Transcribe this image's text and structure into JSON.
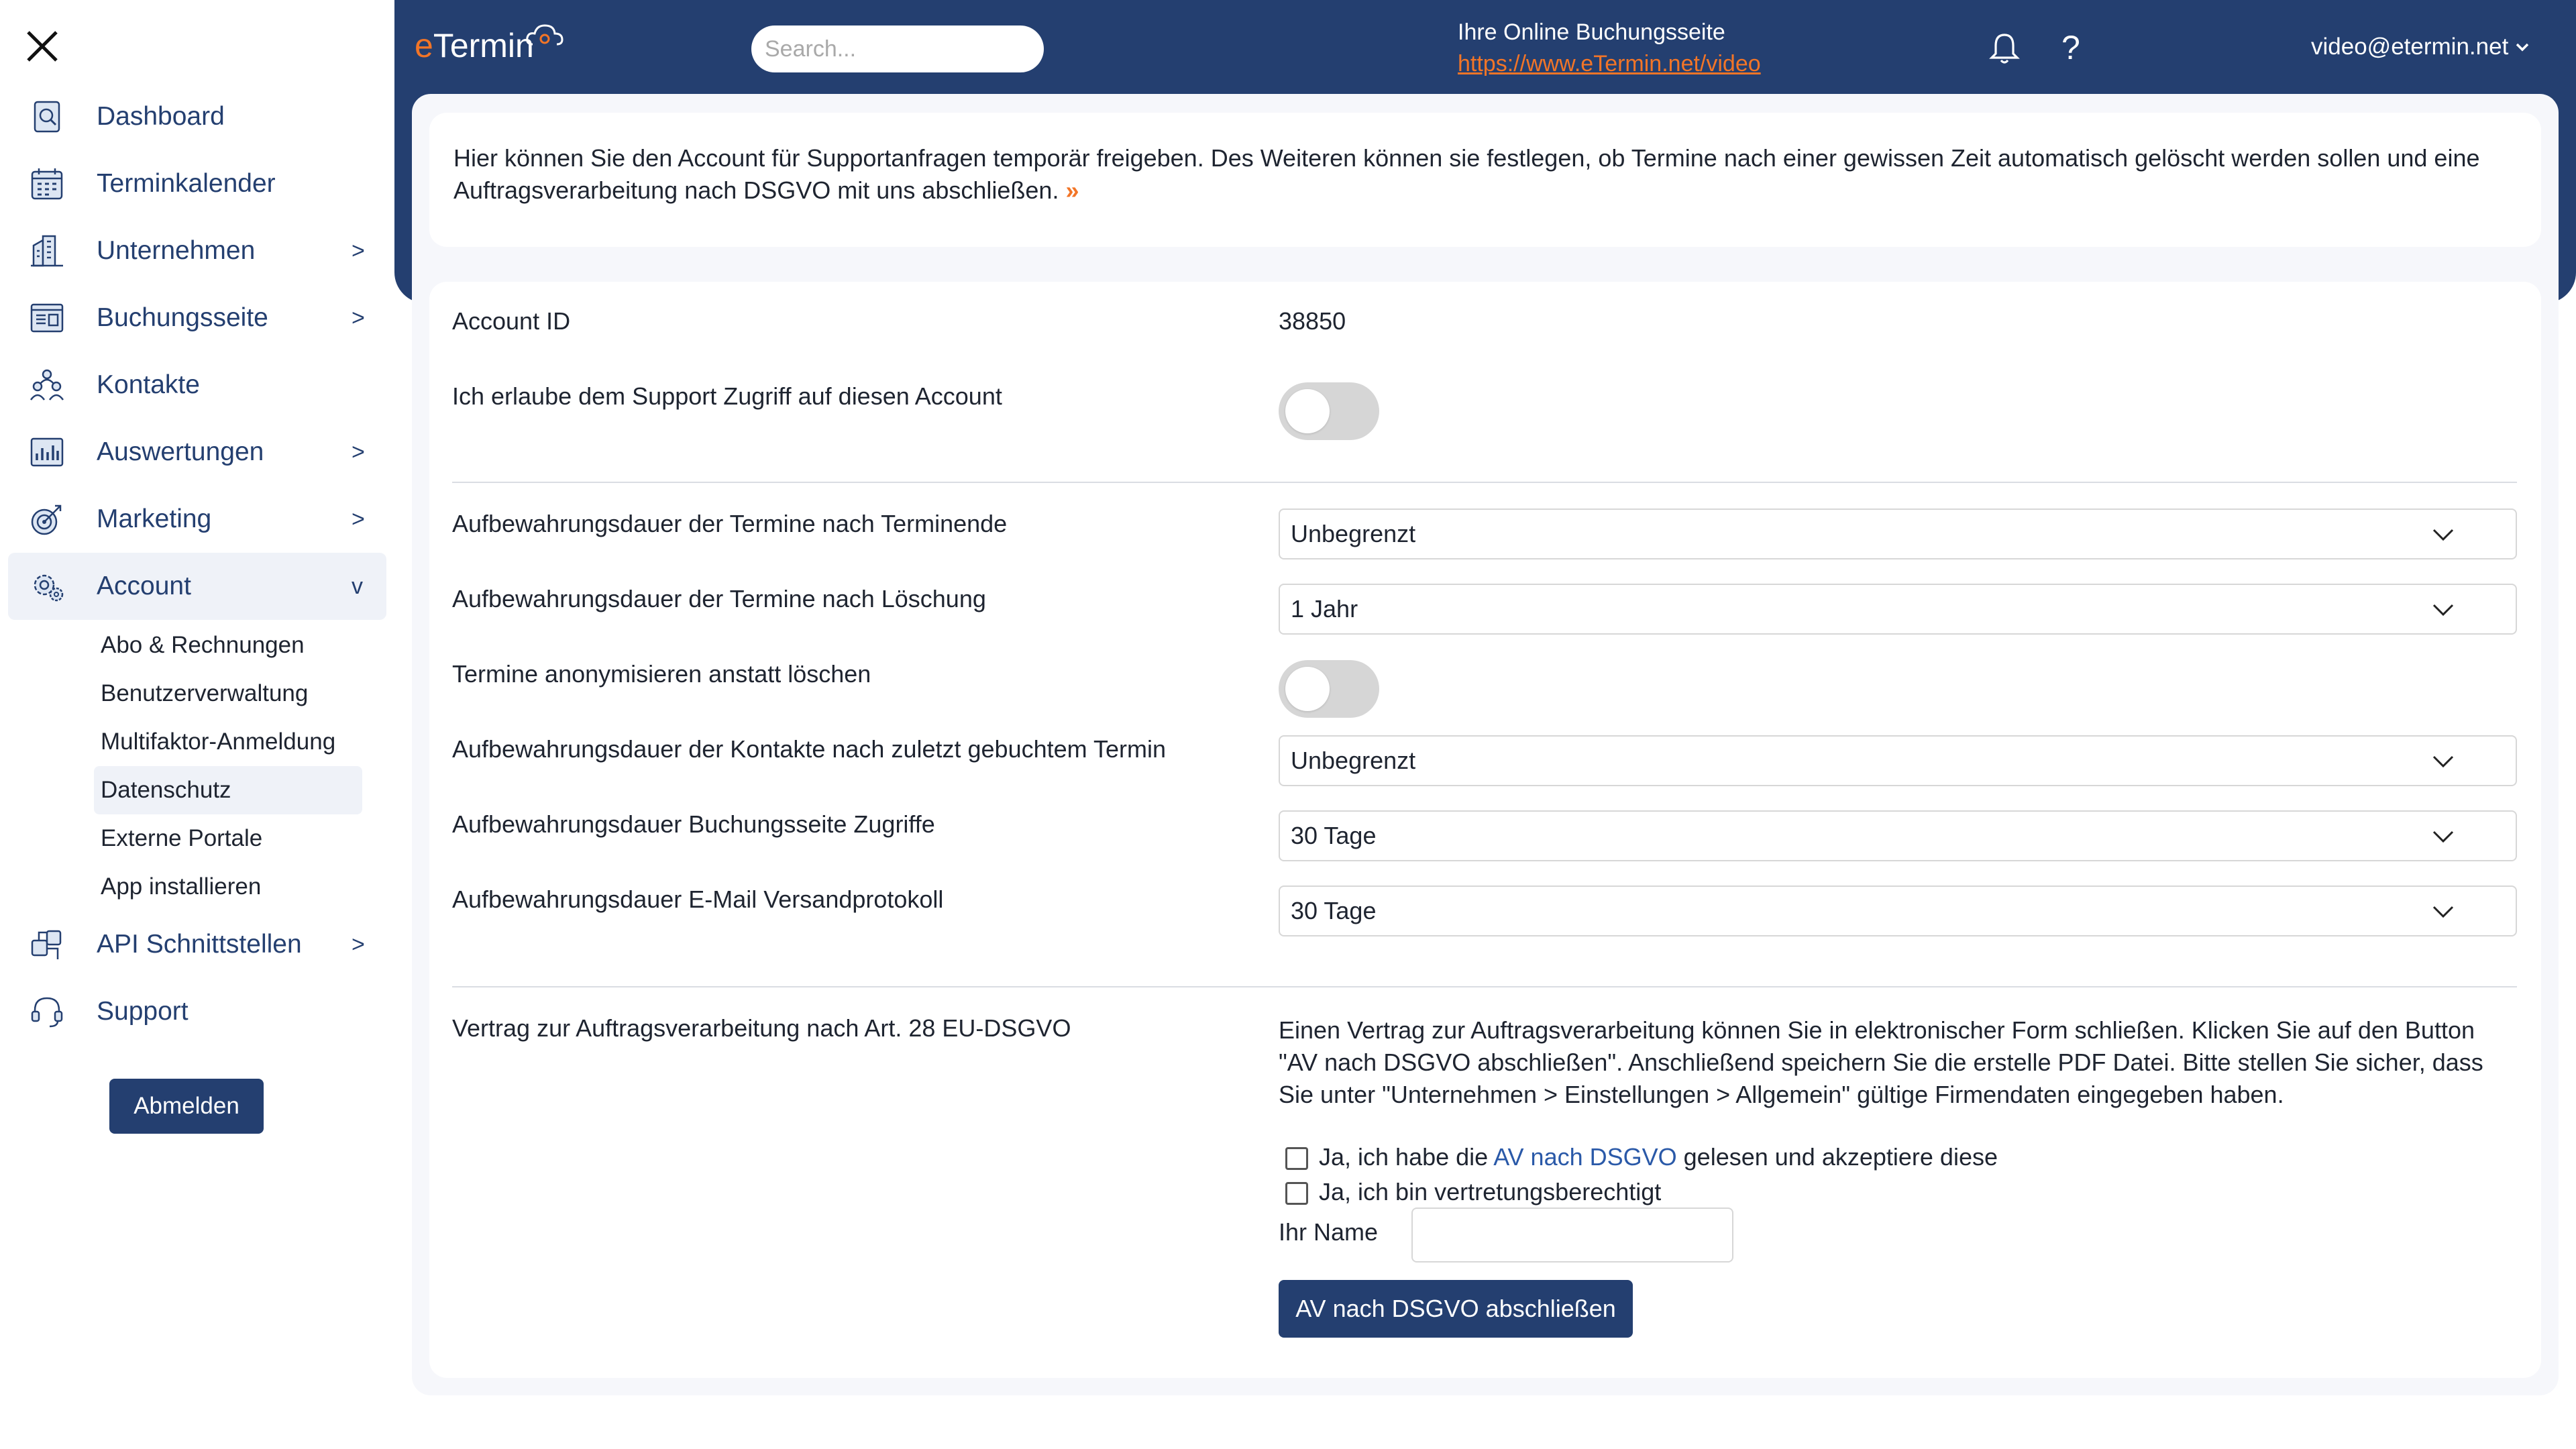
{
  "header": {
    "logo_e": "e",
    "logo_rest": "Termin",
    "search_placeholder": "Search...",
    "booking_title": "Ihre Online Buchungsseite",
    "booking_url": "https://www.eTermin.net/video",
    "help": "?",
    "user_email": "video@etermin.net",
    "user_caret": "⌄"
  },
  "sidebar": {
    "items": [
      {
        "label": "Dashboard",
        "chev": ""
      },
      {
        "label": "Terminkalender",
        "chev": ""
      },
      {
        "label": "Unternehmen",
        "chev": ">"
      },
      {
        "label": "Buchungsseite",
        "chev": ">"
      },
      {
        "label": "Kontakte",
        "chev": ""
      },
      {
        "label": "Auswertungen",
        "chev": ">"
      },
      {
        "label": "Marketing",
        "chev": ">"
      },
      {
        "label": "Account",
        "chev": "v"
      }
    ],
    "sub_items": [
      {
        "label": "Abo & Rechnungen"
      },
      {
        "label": "Benutzerverwaltung"
      },
      {
        "label": "Multifaktor-Anmeldung"
      },
      {
        "label": "Datenschutz"
      },
      {
        "label": "Externe Portale"
      },
      {
        "label": "App installieren"
      }
    ],
    "items2": [
      {
        "label": "API Schnittstellen",
        "chev": ">"
      },
      {
        "label": "Support",
        "chev": ""
      }
    ],
    "logout": "Abmelden"
  },
  "intro": {
    "text": "Hier können Sie den Account für Supportanfragen temporär freigeben. Des Weiteren können sie festlegen, ob Termine nach einer gewissen Zeit automatisch gelöscht werden sollen und eine Auftragsverarbeitung nach DSGVO mit uns abschließen.",
    "more": "»"
  },
  "settings": {
    "account_id_label": "Account ID",
    "account_id_value": "38850",
    "support_label": "Ich erlaube dem Support Zugriff auf diesen Account",
    "support_enabled": false,
    "ret_end_label": "Aufbewahrungsdauer der Termine nach Terminende",
    "ret_end_value": "Unbegrenzt",
    "ret_del_label": "Aufbewahrungsdauer der Termine nach Löschung",
    "ret_del_value": "1 Jahr",
    "anon_label": "Termine anonymisieren anstatt löschen",
    "anon_enabled": false,
    "ret_contacts_label": "Aufbewahrungsdauer der Kontakte nach zuletzt gebuchtem Termin",
    "ret_contacts_value": "Unbegrenzt",
    "ret_booking_label": "Aufbewahrungsdauer Buchungsseite Zugriffe",
    "ret_booking_value": "30 Tage",
    "ret_email_label": "Aufbewahrungsdauer E-Mail Versandprotokoll",
    "ret_email_value": "30 Tage"
  },
  "av": {
    "label": "Vertrag zur Auftragsverarbeitung nach Art. 28 EU-DSGVO",
    "text": "Einen Vertrag zur Auftragsverarbeitung können Sie in elektronischer Form schließen. Klicken Sie auf den Button \"AV nach DSGVO abschließen\". Anschließend speichern Sie die erstelle PDF Datei. Bitte stellen Sie sicher, dass Sie unter \"Unternehmen > Einstellungen > Allgemein\" gültige Firmendaten eingegeben haben.",
    "check1_pre": "Ja, ich habe die ",
    "check1_link": "AV nach DSGVO",
    "check1_post": " gelesen und akzeptiere diese",
    "check2": "Ja, ich bin vertretungsberechtigt",
    "name_label": "Ihr Name",
    "button": "AV nach DSGVO abschließen"
  },
  "colors": {
    "brand": "#243f70",
    "accent": "#f27527",
    "link": "#2a59a8"
  },
  "icons": [
    "close-icon",
    "dashboard-icon",
    "calendar-icon",
    "building-icon",
    "booking-page-icon",
    "contacts-icon",
    "analytics-icon",
    "marketing-icon",
    "account-gear-icon",
    "api-icon",
    "support-icon",
    "bell-icon",
    "chevron-down-icon"
  ]
}
